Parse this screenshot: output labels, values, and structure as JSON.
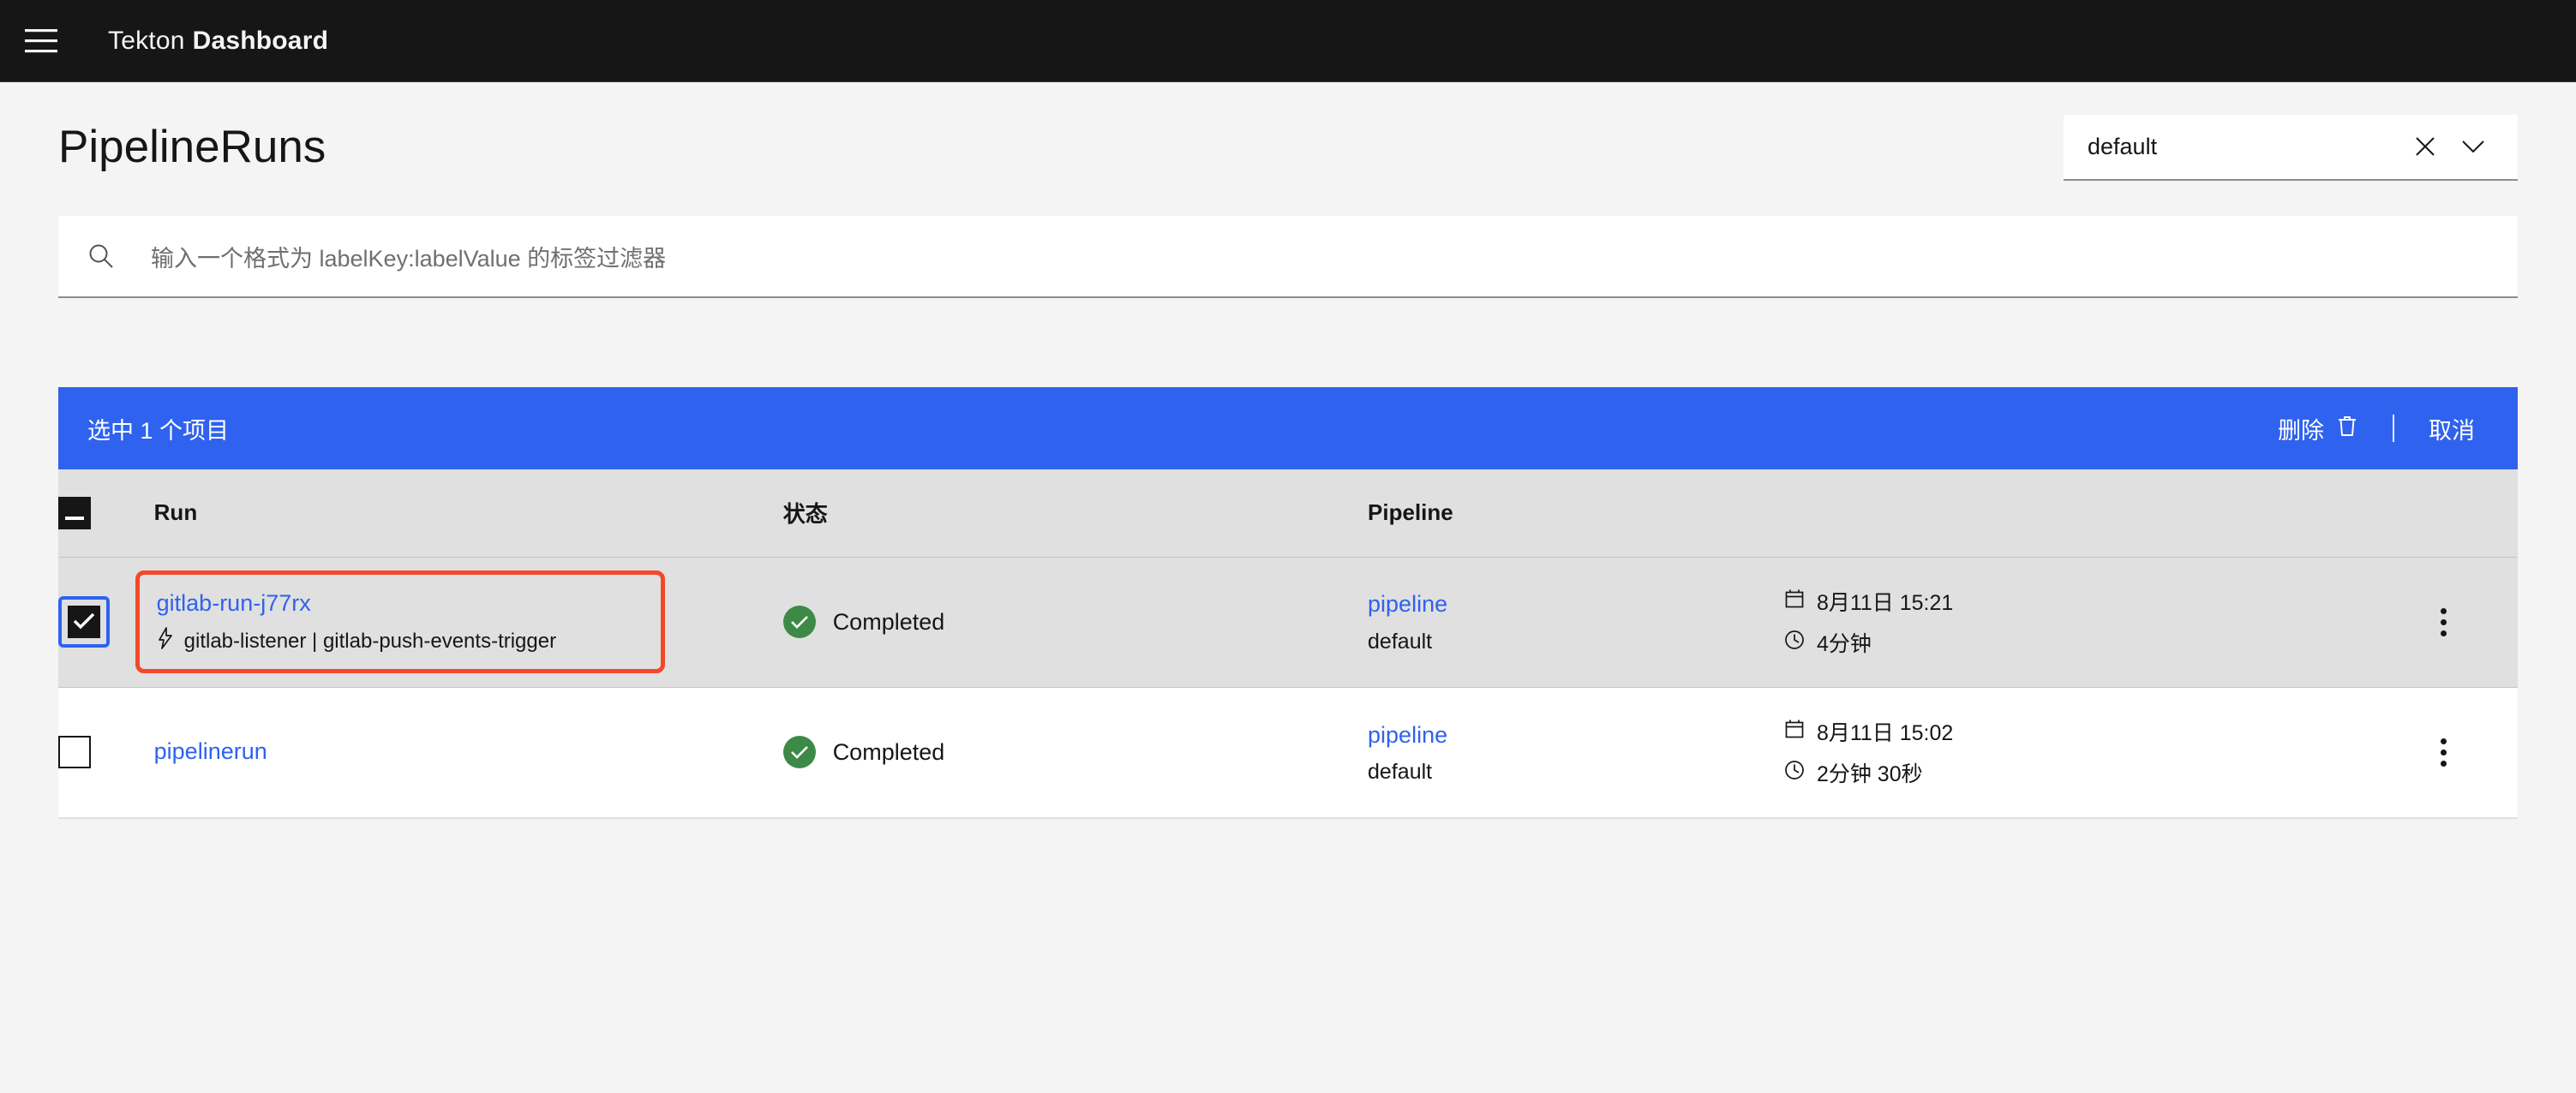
{
  "header": {
    "menu_icon": "hamburger-menu-icon",
    "title_light": "Tekton",
    "title_bold": "Dashboard"
  },
  "page": {
    "title": "PipelineRuns"
  },
  "namespace_selector": {
    "value": "default",
    "clear_icon": "close-icon",
    "expand_icon": "chevron-down-icon"
  },
  "search": {
    "icon": "search-icon",
    "placeholder": "输入一个格式为 labelKey:labelValue 的标签过滤器",
    "value": ""
  },
  "batch_bar": {
    "selection_text": "选中 1 个项目",
    "delete_label": "删除",
    "delete_icon": "trash-icon",
    "cancel_label": "取消",
    "background_color": "#2f62ee"
  },
  "table": {
    "columns": [
      {
        "key": "run",
        "label": "Run"
      },
      {
        "key": "status",
        "label": "状态"
      },
      {
        "key": "pipeline",
        "label": "Pipeline"
      }
    ],
    "header_checkbox_state": "indeterminate",
    "rows": [
      {
        "selected": true,
        "highlighted": true,
        "run_name": "gitlab-run-j77rx",
        "trigger_icon": "lightning-bolt-icon",
        "trigger_text": "gitlab-listener | gitlab-push-events-trigger",
        "status_icon": "check-circle-filled-icon",
        "status_color": "#3d8a48",
        "status_text": "Completed",
        "pipeline_name": "pipeline",
        "pipeline_namespace": "default",
        "date_icon": "calendar-icon",
        "date_text": "8月11日 15:21",
        "duration_icon": "clock-icon",
        "duration_text": "4分钟",
        "overflow_icon": "overflow-menu-icon"
      },
      {
        "selected": false,
        "highlighted": false,
        "run_name": "pipelinerun",
        "trigger_icon": "",
        "trigger_text": "",
        "status_icon": "check-circle-filled-icon",
        "status_color": "#3d8a48",
        "status_text": "Completed",
        "pipeline_name": "pipeline",
        "pipeline_namespace": "default",
        "date_icon": "calendar-icon",
        "date_text": "8月11日 15:02",
        "duration_icon": "clock-icon",
        "duration_text": "2分钟 30秒",
        "overflow_icon": "overflow-menu-icon"
      }
    ]
  },
  "annotation": {
    "highlight_color": "#f4482a",
    "focus_color": "#2f62ee"
  }
}
